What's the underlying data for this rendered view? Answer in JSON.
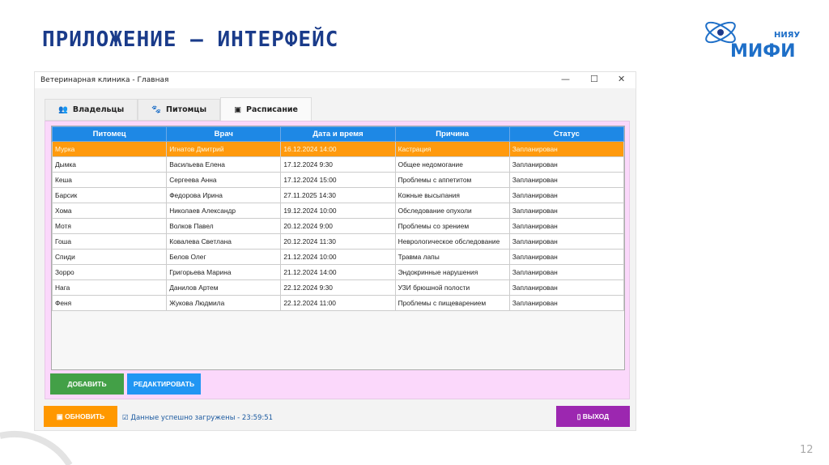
{
  "slide": {
    "title": "ПРИЛОЖЕНИЕ – ИНТЕРФЕЙС",
    "page_number": "12",
    "logo": {
      "top": "НИЯУ",
      "main": "МИФИ"
    }
  },
  "window": {
    "title": "Ветеринарная клиника - Главная",
    "minimize": "—",
    "maximize": "☐",
    "close": "✕"
  },
  "tabs": [
    {
      "label": "Владельцы",
      "icon": "👥"
    },
    {
      "label": "Питомцы",
      "icon": "🐾"
    },
    {
      "label": "Расписание",
      "icon": "▣"
    }
  ],
  "table": {
    "columns": [
      "Питомец",
      "Врач",
      "Дата и время",
      "Причина",
      "Статус"
    ],
    "rows": [
      [
        "Мурка",
        "Игнатов Дмитрий",
        "16.12.2024 14:00",
        "Кастрация",
        "Запланирован"
      ],
      [
        "Дымка",
        "Васильева Елена",
        "17.12.2024 9:30",
        "Общее недомогание",
        "Запланирован"
      ],
      [
        "Кеша",
        "Сергеева Анна",
        "17.12.2024 15:00",
        "Проблемы с аппетитом",
        "Запланирован"
      ],
      [
        "Барсик",
        "Федорова Ирина",
        "27.11.2025 14:30",
        "Кожные высыпания",
        "Запланирован"
      ],
      [
        "Хома",
        "Николаев Александр",
        "19.12.2024 10:00",
        "Обследование опухоли",
        "Запланирован"
      ],
      [
        "Мотя",
        "Волков Павел",
        "20.12.2024 9:00",
        "Проблемы со зрением",
        "Запланирован"
      ],
      [
        "Гоша",
        "Ковалева Светлана",
        "20.12.2024 11:30",
        "Неврологическое обследование",
        "Запланирован"
      ],
      [
        "Спиди",
        "Белов Олег",
        "21.12.2024 10:00",
        "Травма лапы",
        "Запланирован"
      ],
      [
        "Зорро",
        "Григорьева Марина",
        "21.12.2024 14:00",
        "Эндокринные нарушения",
        "Запланирован"
      ],
      [
        "Нага",
        "Данилов Артем",
        "22.12.2024 9:30",
        "УЗИ брюшной полости",
        "Запланирован"
      ],
      [
        "Феня",
        "Жукова Людмила",
        "22.12.2024 11:00",
        "Проблемы с пищеварением",
        "Запланирован"
      ]
    ]
  },
  "buttons": {
    "add": "ДОБАВИТЬ",
    "edit": "РЕДАКТИРОВАТЬ",
    "refresh": "▣ ОБНОВИТЬ",
    "exit": "▯ ВЫХОД"
  },
  "status": "☑ Данные успешно загружены - 23:59:51",
  "colors": {
    "header": "#1e88e5",
    "selected": "#ff9a0e",
    "add": "#43a047",
    "edit": "#2196f3",
    "refresh": "#ff9800",
    "exit": "#9c27b0"
  }
}
